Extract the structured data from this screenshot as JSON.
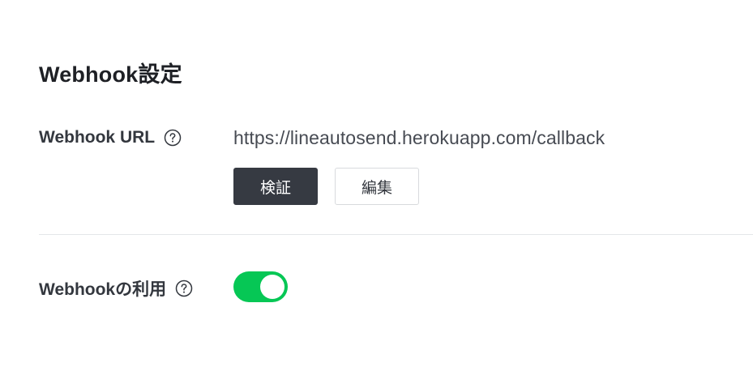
{
  "section": {
    "title": "Webhook設定"
  },
  "webhook_url": {
    "label": "Webhook URL",
    "help_icon": "question-circle-icon",
    "value": "https://lineautosend.herokuapp.com/callback",
    "verify_label": "検証",
    "edit_label": "編集"
  },
  "webhook_use": {
    "label": "Webhookの利用",
    "help_icon": "question-circle-icon",
    "enabled": true
  },
  "colors": {
    "toggle_on": "#06c755",
    "primary_button": "#363a42"
  }
}
